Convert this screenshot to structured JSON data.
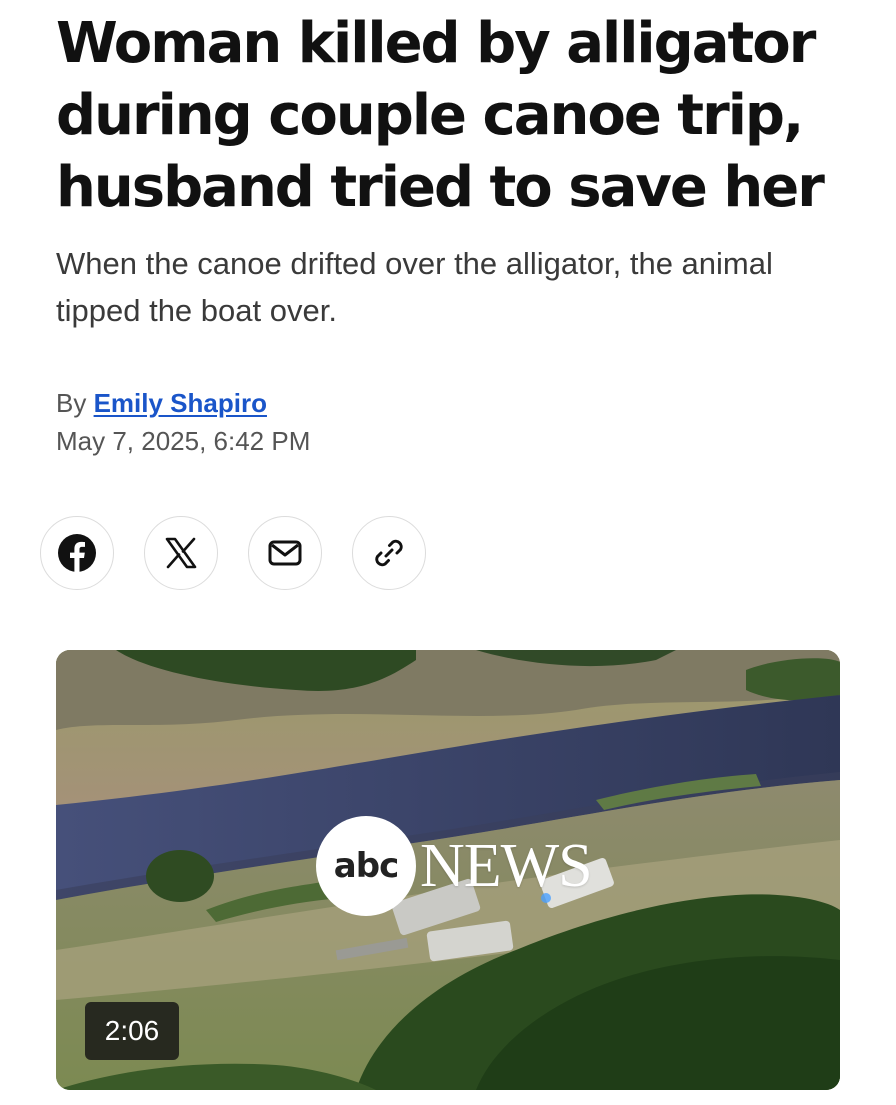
{
  "article": {
    "headline": "Woman killed by alligator during couple canoe trip, husband tried to save her",
    "subheadline": "When the canoe drifted over the alligator, the animal tipped the boat over.",
    "byline_prefix": "By",
    "author": "Emily Shapiro",
    "published": "May 7, 2025, 6:42 PM"
  },
  "share": {
    "icons": [
      "facebook-icon",
      "x-icon",
      "email-icon",
      "link-icon"
    ]
  },
  "video": {
    "logo_circle_text": "abc",
    "logo_word": "NEWS",
    "duration": "2:06"
  },
  "colors": {
    "headline": "#111111",
    "author_link": "#1a55c9",
    "meta_text": "#555555"
  }
}
